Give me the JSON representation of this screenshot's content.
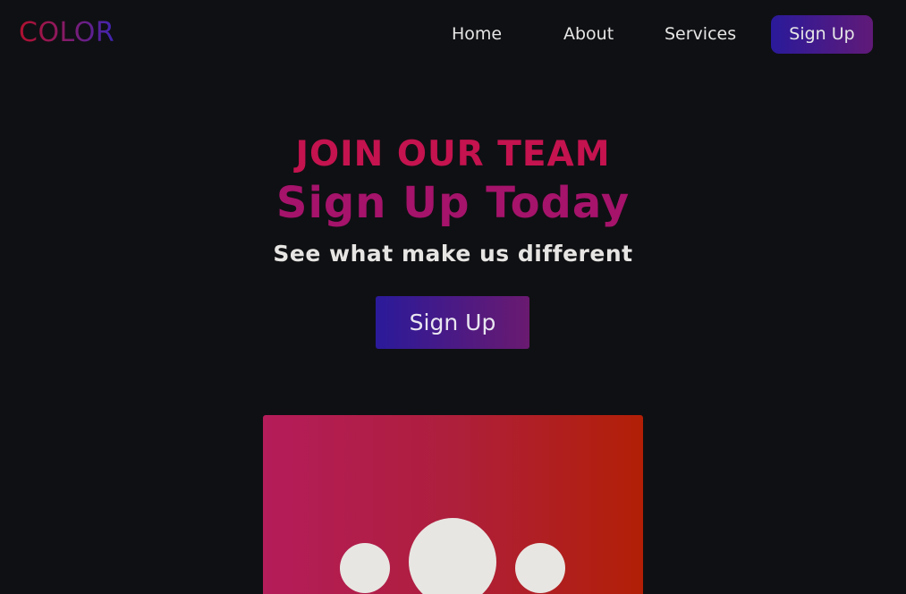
{
  "logo": "COLOR",
  "nav": {
    "home": "Home",
    "about": "About",
    "services": "Services",
    "signup": "Sign Up"
  },
  "hero": {
    "kicker": "JOIN OUR TEAM",
    "title": "Sign Up Today",
    "subtitle": "See what make us different",
    "button": "Sign Up"
  },
  "colors": {
    "background": "#0f1013",
    "kicker": "#c4134f",
    "title": "#a5136b",
    "button_gradient_start": "#2a1a9a",
    "button_gradient_end": "#6a1a70",
    "illustration_gradient_start": "#b41c5a",
    "illustration_gradient_end": "#b21f06"
  },
  "illustration": {
    "icon": "team-people-icon"
  }
}
